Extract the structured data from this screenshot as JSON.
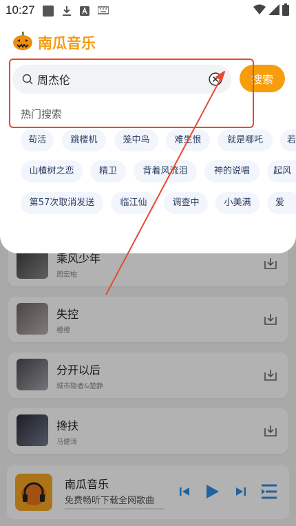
{
  "status_bar": {
    "time": "10:27",
    "left_icons": [
      "gallery-icon",
      "download-icon",
      "a-icon",
      "keyboard-icon"
    ],
    "right_icons": [
      "wifi-icon",
      "signal-icon",
      "battery-icon"
    ]
  },
  "header": {
    "logo_icon": "pumpkin-icon",
    "app_name": "南瓜音乐"
  },
  "search": {
    "value": "周杰伦",
    "placeholder": "",
    "search_button_label": "搜索",
    "icons": [
      "search-icon",
      "clear-icon"
    ]
  },
  "hot_search": {
    "title": "热门搜索",
    "rows": [
      [
        "苟活",
        "跳楼机",
        "笼中鸟",
        "难生恨",
        "就是哪吒",
        "若"
      ],
      [
        "山楂树之恋",
        "精卫",
        "背着风流泪",
        "神的说唱",
        "起风"
      ],
      [
        "第57次取消发送",
        "临江仙",
        "调查中",
        "小美满",
        "爱"
      ]
    ]
  },
  "songs": [
    {
      "title": "乘风少年",
      "artist": "周宏柏"
    },
    {
      "title": "失控",
      "artist": "橙橙"
    },
    {
      "title": "分开以后",
      "artist": "城市隐者&楚静"
    },
    {
      "title": "搀扶",
      "artist": "马健涛"
    }
  ],
  "player": {
    "title": "南瓜音乐",
    "subtitle": "免费畅听下载全网歌曲",
    "progress": 0.0,
    "icons": [
      "headphones-icon",
      "previous-icon",
      "play-icon",
      "next-icon",
      "playlist-icon"
    ]
  },
  "colors": {
    "accent": "#f79d0c",
    "brand": "#f39c12",
    "tag_bg": "#f2f5fb",
    "tag_text": "#2a3e62",
    "annotation": "#e8492f"
  }
}
